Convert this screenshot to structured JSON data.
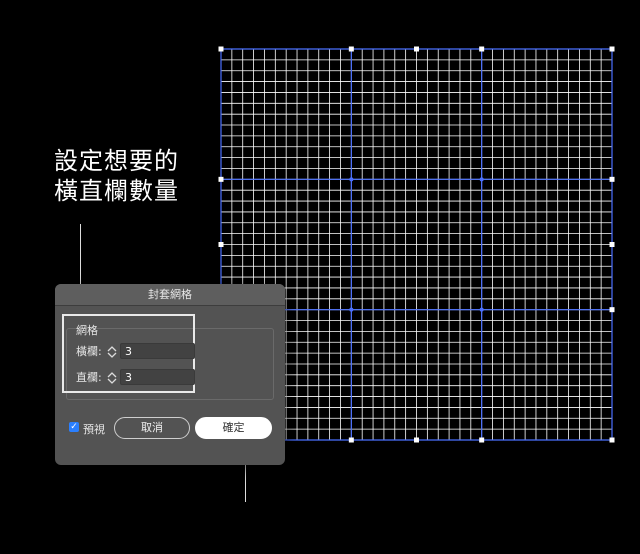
{
  "annotation": {
    "line1": "設定想要的",
    "line2": "橫直欄數量"
  },
  "dialog": {
    "title": "封套網格",
    "group_label": "網格",
    "rows_label": "橫欄:",
    "rows_value": "3",
    "cols_label": "直欄:",
    "cols_value": "3",
    "preview_label": "預視",
    "preview_checked": true,
    "cancel_label": "取消",
    "ok_label": "確定"
  },
  "grid": {
    "major_rows": 3,
    "major_cols": 3,
    "minor_lines_per_axis": 36,
    "line_color": "#ffffff",
    "major_line_color": "#4a6fff",
    "anchor_color": "#ffffff"
  }
}
